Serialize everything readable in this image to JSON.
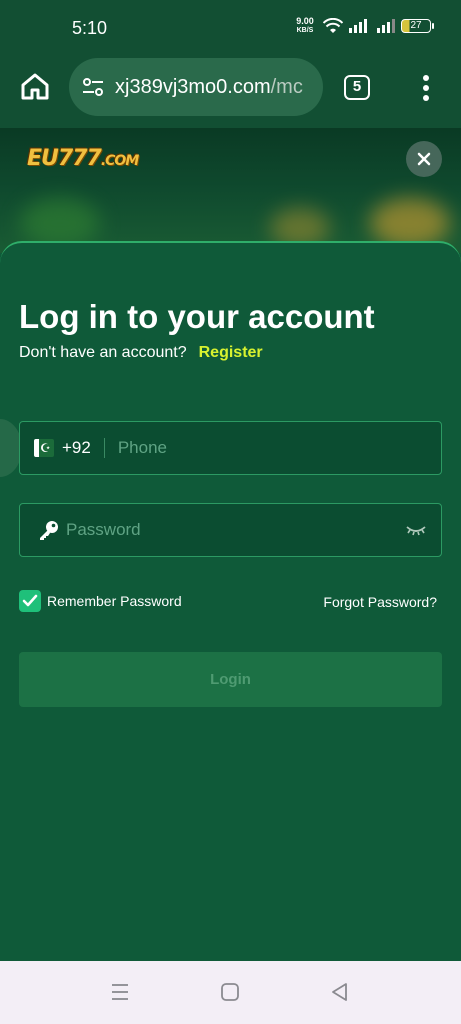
{
  "status_bar": {
    "time": "5:10",
    "net_speed_value": "9.00",
    "net_speed_unit": "KB/S",
    "battery": "27"
  },
  "browser": {
    "url_main": "xj389vj3mo0.com",
    "url_rest": "/mc",
    "tab_count": "5"
  },
  "site": {
    "logo_main": "EU777",
    "logo_suffix": ".COM"
  },
  "login": {
    "title": "Log in to your account",
    "no_account_text": "Don't have an account?",
    "register_link": "Register",
    "country_code": "+92",
    "phone_placeholder": "Phone",
    "password_placeholder": "Password",
    "remember_label": "Remember Password",
    "remember_checked": true,
    "forgot_link": "Forgot Password?",
    "login_button": "Login"
  },
  "colors": {
    "background": "#0f5a39",
    "accent": "#d8f22f",
    "checkbox": "#1fc07a",
    "border": "#2c9a63"
  },
  "icons": [
    "home-icon",
    "site-settings-icon",
    "more-vert-icon",
    "close-icon",
    "pakistan-flag-icon",
    "key-icon",
    "eye-closed-icon",
    "check-icon",
    "menu-icon",
    "square-icon",
    "back-icon"
  ]
}
